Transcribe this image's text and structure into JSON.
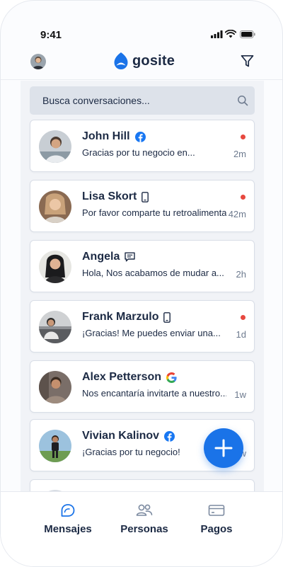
{
  "status_bar": {
    "time": "9:41"
  },
  "header": {
    "brand": "gosite"
  },
  "search": {
    "placeholder": "Busca conversaciones..."
  },
  "conversations": [
    {
      "name": "John Hill",
      "message": "Gracias por tu negocio en...",
      "time": "2m",
      "channel": "facebook-icon",
      "unread": true
    },
    {
      "name": "Lisa Skort",
      "message": "Por favor comparte tu retroalimentación",
      "time": "42m",
      "channel": "phone-icon",
      "unread": true
    },
    {
      "name": "Angela",
      "message": "Hola, Nos acabamos de mudar a...",
      "time": "2h",
      "channel": "chat-icon",
      "unread": false
    },
    {
      "name": "Frank Marzulo",
      "message": "¡Gracias! Me puedes enviar una...",
      "time": "1d",
      "channel": "phone-icon",
      "unread": true
    },
    {
      "name": "Alex Petterson",
      "message": "Nos encantaría invitarte a nuestro...",
      "time": "1w",
      "channel": "google-icon",
      "unread": false
    },
    {
      "name": "Vivian Kalinov",
      "message": "¡Gracias por tu negocio!",
      "time": "1w",
      "channel": "facebook-icon",
      "unread": false
    }
  ],
  "bottom_nav": [
    {
      "label": "Mensajes",
      "icon": "messages-icon",
      "active": true
    },
    {
      "label": "Personas",
      "icon": "people-icon",
      "active": false
    },
    {
      "label": "Pagos",
      "icon": "card-icon",
      "active": false
    }
  ],
  "colors": {
    "accent": "#1a73e8",
    "unread_dot": "#e7483f",
    "text": "#1c2a44",
    "muted": "#6d7a8e",
    "list_bg": "#f1f3f7"
  }
}
